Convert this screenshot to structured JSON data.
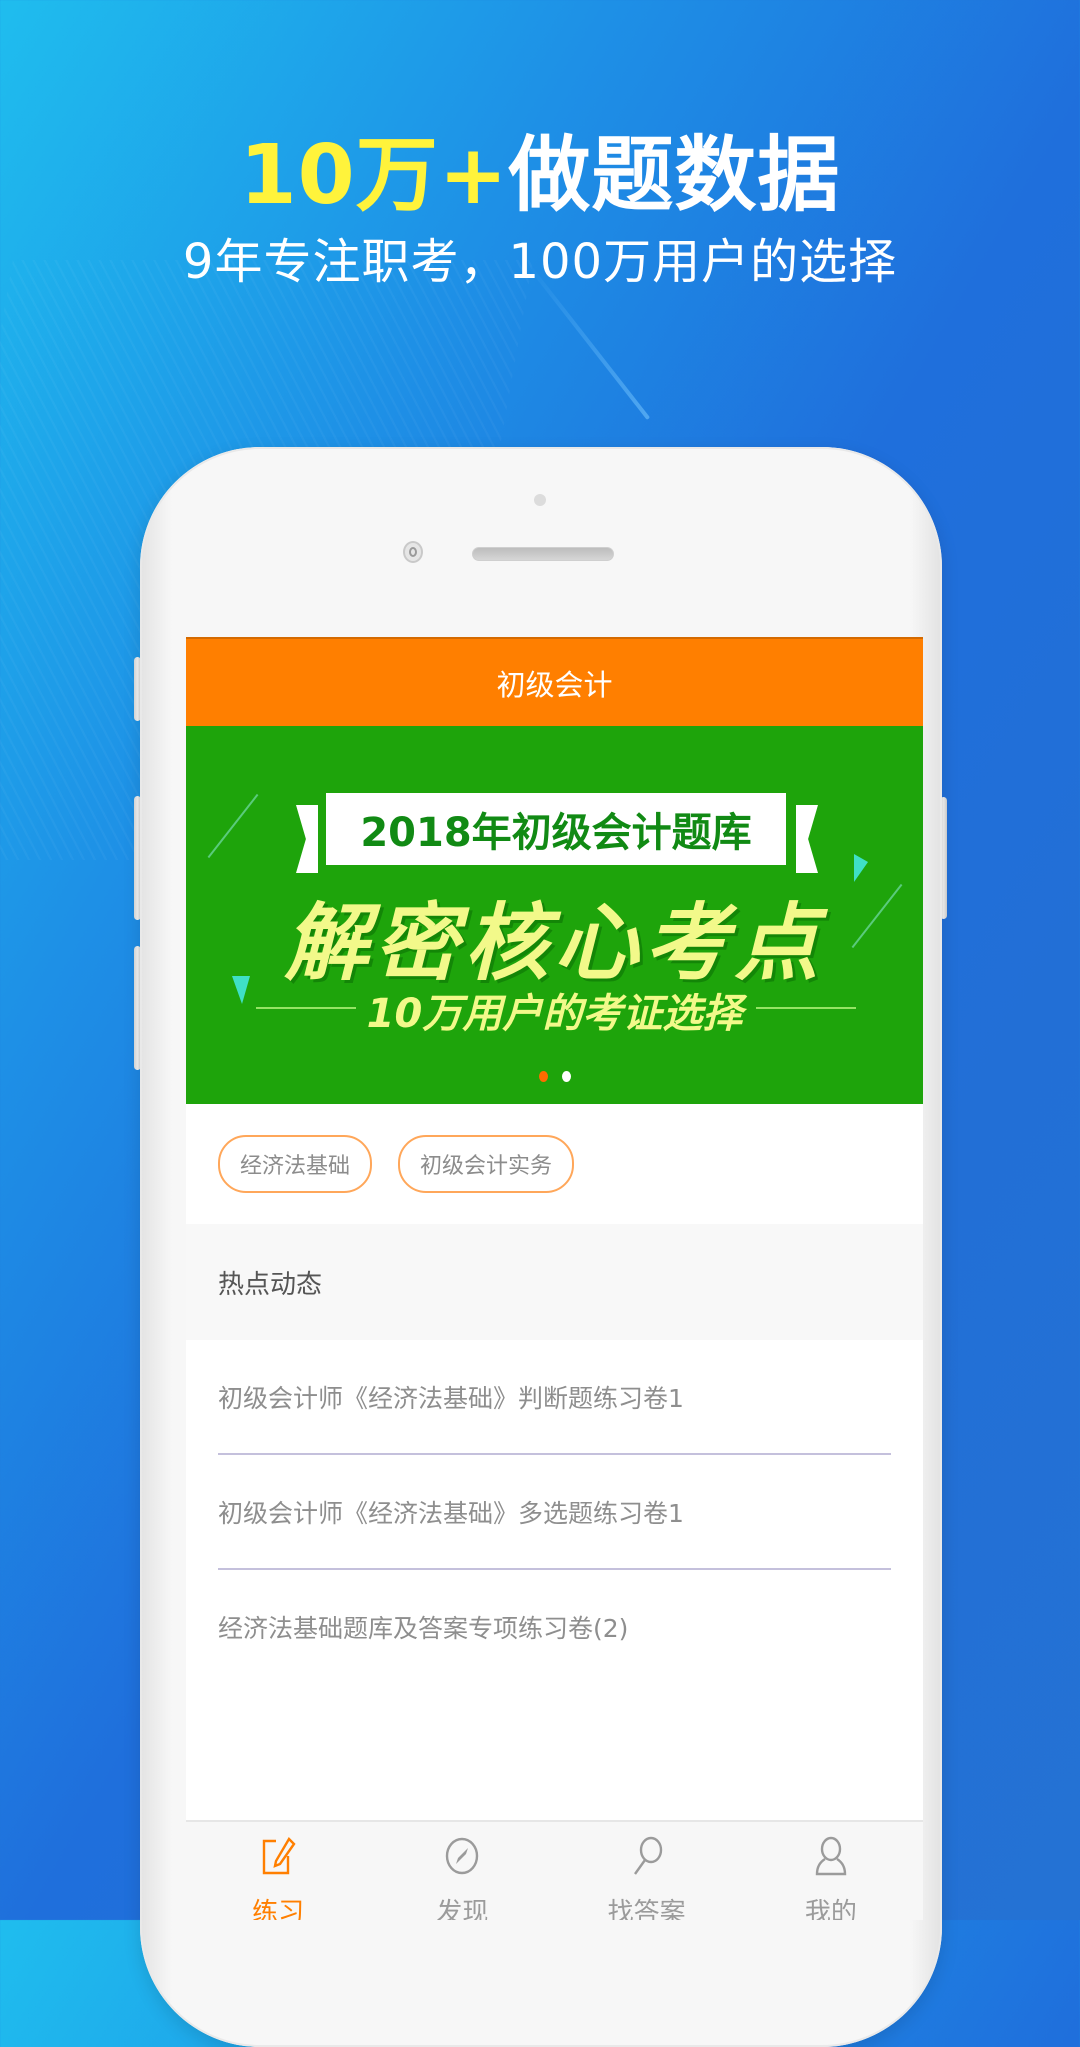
{
  "promo": {
    "headline_highlight": "10万+",
    "headline_rest": "做题数据",
    "subtitle": "9年专注职考，100万用户的选择"
  },
  "app": {
    "header_title": "初级会计",
    "banner": {
      "ribbon_text": "2018年初级会计题库",
      "main_text": "解密核心考点",
      "tagline": "10万用户的考证选择",
      "slide_count": 2,
      "active_slide": 1
    },
    "tags": [
      {
        "label": "经济法基础"
      },
      {
        "label": "初级会计实务"
      }
    ],
    "section_title": "热点动态",
    "news": [
      {
        "title": "初级会计师《经济法基础》判断题练习卷1"
      },
      {
        "title": "初级会计师《经济法基础》多选题练习卷1"
      },
      {
        "title": "经济法基础题库及答案专项练习卷(2)"
      }
    ],
    "tabbar": [
      {
        "label": "练习",
        "icon": "edit-icon",
        "active": true
      },
      {
        "label": "发现",
        "icon": "compass-icon",
        "active": false
      },
      {
        "label": "找答案",
        "icon": "search-icon",
        "active": false
      },
      {
        "label": "我的",
        "icon": "user-icon",
        "active": false
      }
    ]
  },
  "colors": {
    "accent_orange": "#ff7f00",
    "banner_green": "#1ea40b",
    "headline_yellow": "#fff33b",
    "background_blue": "#1f6fdc"
  }
}
